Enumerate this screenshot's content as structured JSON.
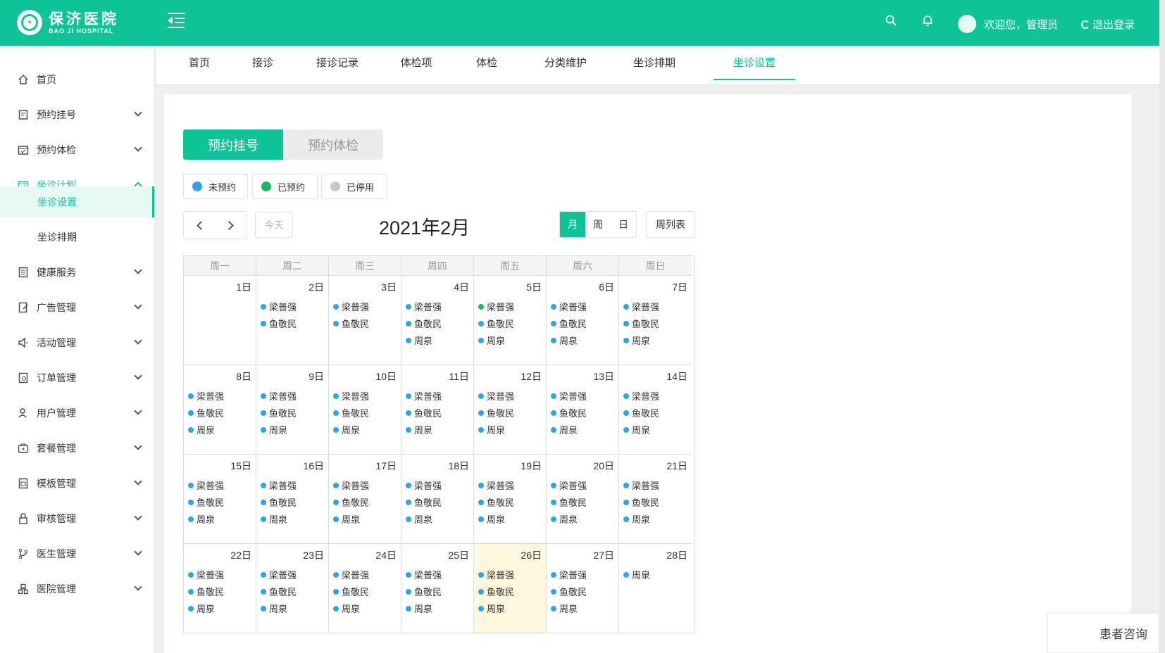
{
  "header": {
    "logo_cn": "保济医院",
    "logo_en": "BAO JI HOSPITAL",
    "welcome": "欢迎您，管理员",
    "logout": "退出登录",
    "color": "#0cc496"
  },
  "sidebar": {
    "items": [
      {
        "label": "首页",
        "icon": "home-icon"
      },
      {
        "label": "预约挂号",
        "icon": "form-icon"
      },
      {
        "label": "预约体检",
        "icon": "calendar-check-icon"
      },
      {
        "label": "坐诊计划",
        "icon": "calendar-icon"
      },
      {
        "label": "健康服务",
        "icon": "document-icon"
      },
      {
        "label": "广告管理",
        "icon": "edit-doc-icon"
      },
      {
        "label": "活动管理",
        "icon": "speaker-icon"
      },
      {
        "label": "订单管理",
        "icon": "order-icon"
      },
      {
        "label": "用户管理",
        "icon": "user-icon"
      },
      {
        "label": "套餐管理",
        "icon": "package-icon"
      },
      {
        "label": "模板管理",
        "icon": "template-icon"
      },
      {
        "label": "审核管理",
        "icon": "lock-icon"
      },
      {
        "label": "医生管理",
        "icon": "branch-icon"
      },
      {
        "label": "医院管理",
        "icon": "hospital-icon"
      }
    ],
    "sub_items": [
      "坐诊设置",
      "坐诊排期"
    ]
  },
  "tabs": [
    "首页",
    "接诊",
    "接诊记录",
    "体检项",
    "体检",
    "分类维护",
    "坐诊排期",
    "坐诊设置"
  ],
  "segment": {
    "on": "预约挂号",
    "off": "预约体检"
  },
  "legend": [
    {
      "label": "未预约",
      "color": "#2ea5e8"
    },
    {
      "label": "已预约",
      "color": "#19b85e"
    },
    {
      "label": "已停用",
      "color": "#c8c8c8"
    }
  ],
  "toolbar": {
    "today": "今天",
    "title": "2021年2月",
    "views": [
      "月",
      "周",
      "日"
    ],
    "week_list": "周列表"
  },
  "calendar": {
    "weekdays": [
      "周一",
      "周二",
      "周三",
      "周四",
      "周五",
      "周六",
      "周日"
    ],
    "days": [
      {
        "day": "1日",
        "events": []
      },
      {
        "day": "2日",
        "events": [
          {
            "name": "梁普强",
            "status": "未预约"
          },
          {
            "name": "鱼敬民",
            "status": "未预约"
          }
        ]
      },
      {
        "day": "3日",
        "events": [
          {
            "name": "梁普强",
            "status": "未预约"
          },
          {
            "name": "鱼敬民",
            "status": "未预约"
          }
        ]
      },
      {
        "day": "4日",
        "events": [
          {
            "name": "梁普强",
            "status": "未预约"
          },
          {
            "name": "鱼敬民",
            "status": "未预约"
          },
          {
            "name": "周泉",
            "status": "未预约"
          }
        ]
      },
      {
        "day": "5日",
        "events": [
          {
            "name": "梁普强",
            "status": "已预约"
          },
          {
            "name": "鱼敬民",
            "status": "未预约"
          },
          {
            "name": "周泉",
            "status": "未预约"
          }
        ]
      },
      {
        "day": "6日",
        "events": [
          {
            "name": "梁普强",
            "status": "未预约"
          },
          {
            "name": "鱼敬民",
            "status": "未预约"
          },
          {
            "name": "周泉",
            "status": "未预约"
          }
        ]
      },
      {
        "day": "7日",
        "events": [
          {
            "name": "梁普强",
            "status": "未预约"
          },
          {
            "name": "鱼敬民",
            "status": "未预约"
          },
          {
            "name": "周泉",
            "status": "未预约"
          }
        ]
      },
      {
        "day": "8日",
        "events": [
          {
            "name": "梁普强",
            "status": "未预约"
          },
          {
            "name": "鱼敬民",
            "status": "未预约"
          },
          {
            "name": "周泉",
            "status": "未预约"
          }
        ]
      },
      {
        "day": "9日",
        "events": [
          {
            "name": "梁普强",
            "status": "未预约"
          },
          {
            "name": "鱼敬民",
            "status": "未预约"
          },
          {
            "name": "周泉",
            "status": "未预约"
          }
        ]
      },
      {
        "day": "10日",
        "events": [
          {
            "name": "梁普强",
            "status": "未预约"
          },
          {
            "name": "鱼敬民",
            "status": "未预约"
          },
          {
            "name": "周泉",
            "status": "未预约"
          }
        ]
      },
      {
        "day": "11日",
        "events": [
          {
            "name": "梁普强",
            "status": "未预约"
          },
          {
            "name": "鱼敬民",
            "status": "未预约"
          },
          {
            "name": "周泉",
            "status": "未预约"
          }
        ]
      },
      {
        "day": "12日",
        "events": [
          {
            "name": "梁普强",
            "status": "未预约"
          },
          {
            "name": "鱼敬民",
            "status": "未预约"
          },
          {
            "name": "周泉",
            "status": "未预约"
          }
        ]
      },
      {
        "day": "13日",
        "events": [
          {
            "name": "梁普强",
            "status": "未预约"
          },
          {
            "name": "鱼敬民",
            "status": "未预约"
          },
          {
            "name": "周泉",
            "status": "未预约"
          }
        ]
      },
      {
        "day": "14日",
        "events": [
          {
            "name": "梁普强",
            "status": "未预约"
          },
          {
            "name": "鱼敬民",
            "status": "未预约"
          },
          {
            "name": "周泉",
            "status": "未预约"
          }
        ]
      },
      {
        "day": "15日",
        "events": [
          {
            "name": "梁普强",
            "status": "未预约"
          },
          {
            "name": "鱼敬民",
            "status": "未预约"
          },
          {
            "name": "周泉",
            "status": "未预约"
          }
        ]
      },
      {
        "day": "16日",
        "events": [
          {
            "name": "梁普强",
            "status": "未预约"
          },
          {
            "name": "鱼敬民",
            "status": "未预约"
          },
          {
            "name": "周泉",
            "status": "未预约"
          }
        ]
      },
      {
        "day": "17日",
        "events": [
          {
            "name": "梁普强",
            "status": "未预约"
          },
          {
            "name": "鱼敬民",
            "status": "未预约"
          },
          {
            "name": "周泉",
            "status": "未预约"
          }
        ]
      },
      {
        "day": "18日",
        "events": [
          {
            "name": "梁普强",
            "status": "未预约"
          },
          {
            "name": "鱼敬民",
            "status": "未预约"
          },
          {
            "name": "周泉",
            "status": "未预约"
          }
        ]
      },
      {
        "day": "19日",
        "events": [
          {
            "name": "梁普强",
            "status": "未预约"
          },
          {
            "name": "鱼敬民",
            "status": "未预约"
          },
          {
            "name": "周泉",
            "status": "未预约"
          }
        ]
      },
      {
        "day": "20日",
        "events": [
          {
            "name": "梁普强",
            "status": "未预约"
          },
          {
            "name": "鱼敬民",
            "status": "未预约"
          },
          {
            "name": "周泉",
            "status": "未预约"
          }
        ]
      },
      {
        "day": "21日",
        "events": [
          {
            "name": "梁普强",
            "status": "未预约"
          },
          {
            "name": "鱼敬民",
            "status": "未预约"
          },
          {
            "name": "周泉",
            "status": "未预约"
          }
        ]
      },
      {
        "day": "22日",
        "events": [
          {
            "name": "梁普强",
            "status": "未预约"
          },
          {
            "name": "鱼敬民",
            "status": "未预约"
          },
          {
            "name": "周泉",
            "status": "未预约"
          }
        ]
      },
      {
        "day": "23日",
        "events": [
          {
            "name": "梁普强",
            "status": "未预约"
          },
          {
            "name": "鱼敬民",
            "status": "未预约"
          },
          {
            "name": "周泉",
            "status": "未预约"
          }
        ]
      },
      {
        "day": "24日",
        "events": [
          {
            "name": "梁普强",
            "status": "未预约"
          },
          {
            "name": "鱼敬民",
            "status": "未预约"
          },
          {
            "name": "周泉",
            "status": "未预约"
          }
        ]
      },
      {
        "day": "25日",
        "events": [
          {
            "name": "梁普强",
            "status": "未预约"
          },
          {
            "name": "鱼敬民",
            "status": "未预约"
          },
          {
            "name": "周泉",
            "status": "未预约"
          }
        ]
      },
      {
        "day": "26日",
        "events": [
          {
            "name": "梁普强",
            "status": "未预约"
          },
          {
            "name": "鱼敬民",
            "status": "未预约"
          },
          {
            "name": "周泉",
            "status": "未预约"
          }
        ],
        "today": true
      },
      {
        "day": "27日",
        "events": [
          {
            "name": "梁普强",
            "status": "未预约"
          },
          {
            "name": "鱼敬民",
            "status": "未预约"
          },
          {
            "name": "周泉",
            "status": "未预约"
          }
        ]
      },
      {
        "day": "28日",
        "events": [
          {
            "name": "周泉",
            "status": "未预约"
          }
        ]
      }
    ]
  },
  "consult": "患者咨询"
}
